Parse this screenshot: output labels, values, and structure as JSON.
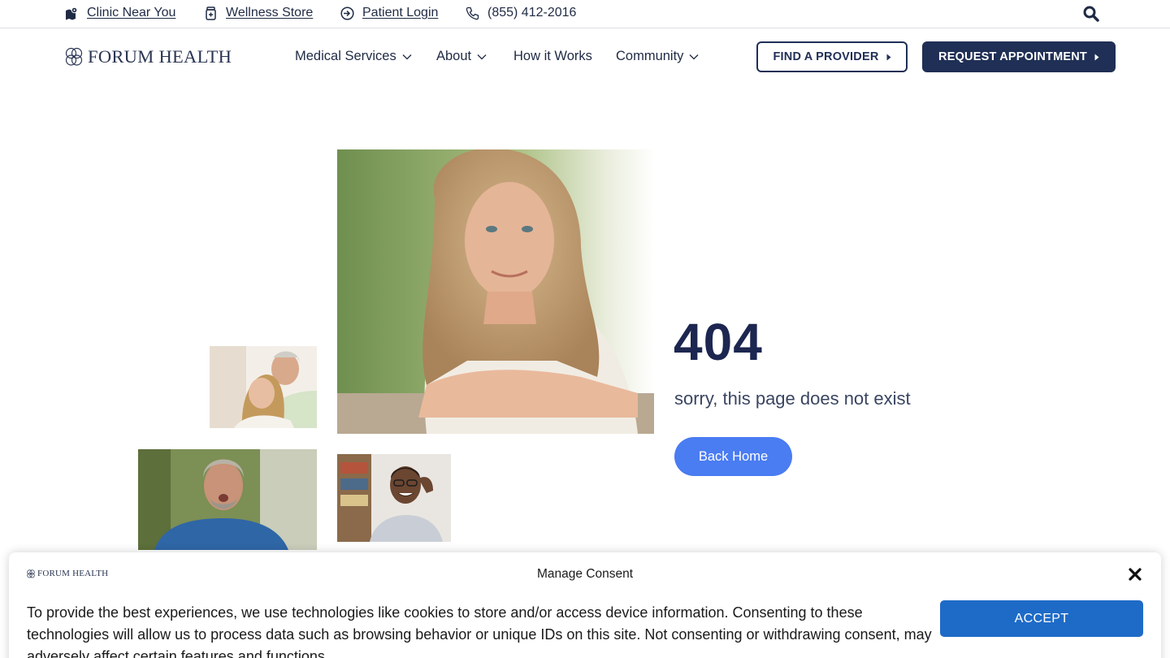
{
  "topbar": {
    "clinic_label": "Clinic Near You",
    "store_label": "Wellness Store",
    "login_label": "Patient Login",
    "phone_label": "(855) 412-2016"
  },
  "header": {
    "logo_text": "FORUM HEALTH",
    "nav": [
      {
        "label": "Medical Services",
        "dropdown": true
      },
      {
        "label": "About",
        "dropdown": true
      },
      {
        "label": "How it Works",
        "dropdown": false
      },
      {
        "label": "Community",
        "dropdown": true
      }
    ],
    "find_provider_label": "FIND A PROVIDER",
    "request_appointment_label": "REQUEST APPOINTMENT"
  },
  "error": {
    "code": "404",
    "message": "sorry, this page does not exist",
    "back_label": "Back Home"
  },
  "consent": {
    "logo_text": "FORUM HEALTH",
    "title": "Manage Consent",
    "body": "To provide the best experiences, we use technologies like cookies to store and/or access device information. Consenting to these technologies will allow us to process data such as browsing behavior or unique IDs on this site. Not consenting or withdrawing consent, may adversely affect certain features and functions.",
    "accept_label": "ACCEPT"
  },
  "colors": {
    "navy": "#1f2f55",
    "accent_blue": "#4a7cf2",
    "accept_blue": "#1e6bc7"
  },
  "icons": [
    "map-icon",
    "store-icon",
    "login-icon",
    "phone-icon",
    "search-icon",
    "chevron-down-icon",
    "caret-right-icon",
    "close-icon"
  ]
}
